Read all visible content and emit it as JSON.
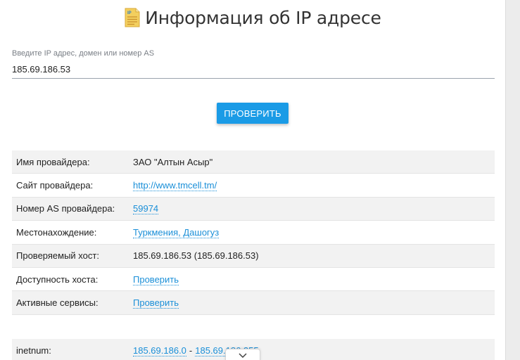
{
  "header": {
    "title": "Информация об IP адресе",
    "icon": "document-ip-icon"
  },
  "search": {
    "label": "Введите IP адрес, домен или номер AS",
    "value": "185.69.186.53"
  },
  "actions": {
    "check_label": "ПРОВЕРИТЬ"
  },
  "info": [
    {
      "label": "Имя провайдера:",
      "value": "ЗАО \"Алтын Асыр\"",
      "link": false
    },
    {
      "label": "Сайт провайдера:",
      "value": "http://www.tmcell.tm/",
      "link": true
    },
    {
      "label": "Номер AS провайдера:",
      "value": "59974",
      "link": true
    },
    {
      "label": "Местонахождение:",
      "value": "Туркмения, Дашогуз",
      "link": true
    },
    {
      "label": "Проверяемый хост:",
      "value": "185.69.186.53 (185.69.186.53)",
      "link": false
    },
    {
      "label": "Доступность хоста:",
      "value": "Проверить",
      "link": true
    },
    {
      "label": "Активные сервисы:",
      "value": "Проверить",
      "link": true
    }
  ],
  "inetnum": {
    "label": "inetnum:",
    "start": "185.69.186.0",
    "separator": "-",
    "end": "185.69.186.255"
  },
  "colors": {
    "accent": "#1a9be6",
    "link": "#1a8fd8"
  }
}
